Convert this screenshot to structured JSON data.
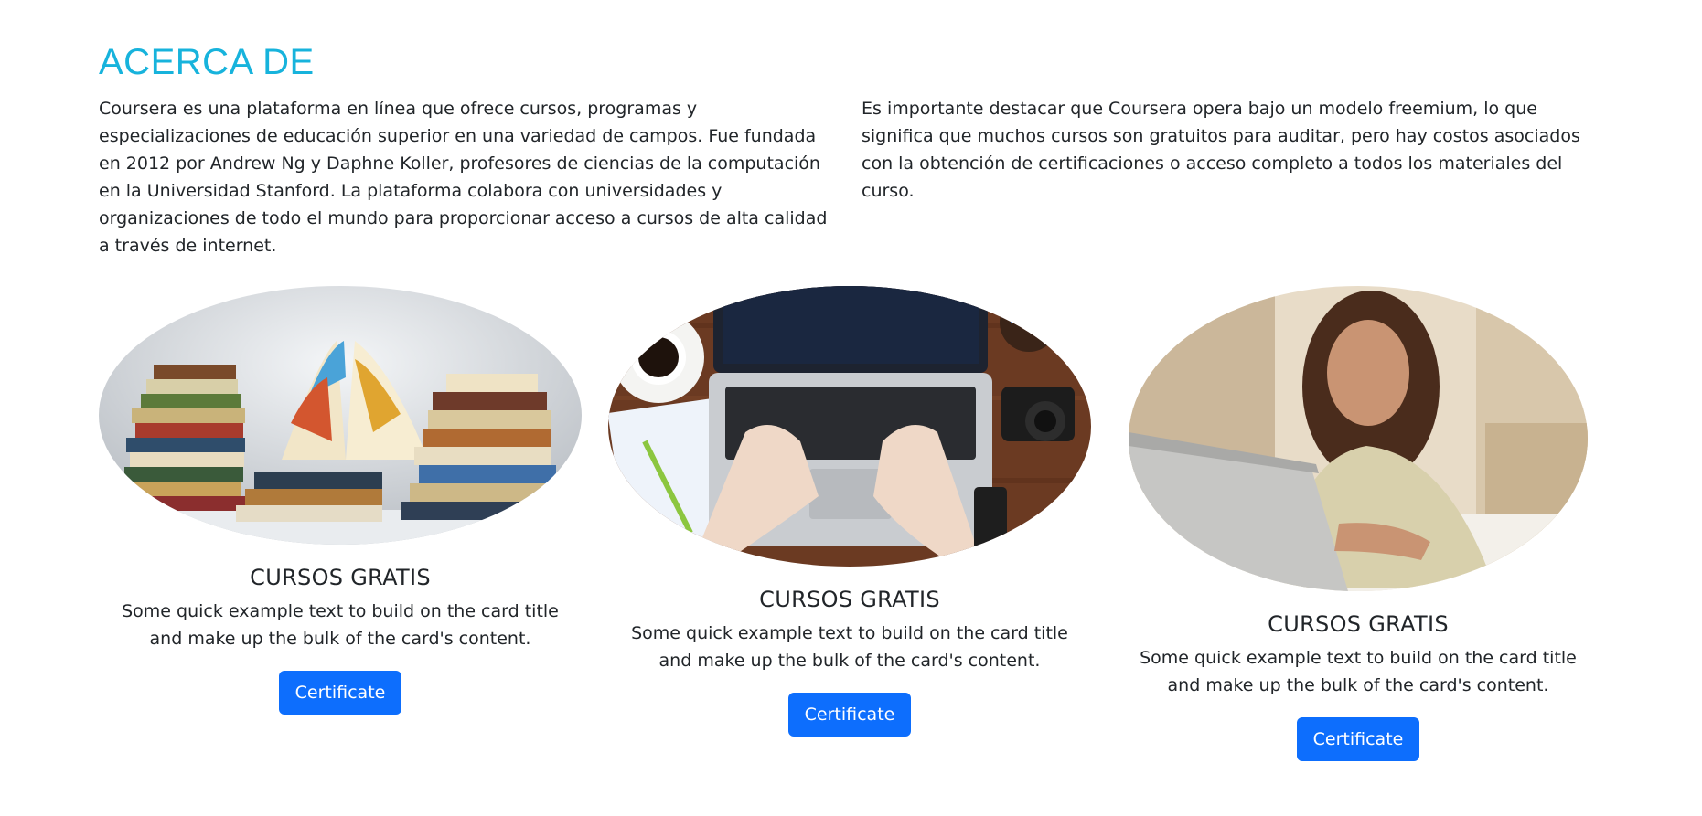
{
  "about": {
    "title": "ACERCA DE",
    "paragraph_left": "Coursera es una plataforma en línea que ofrece cursos, programas y especializaciones de educación superior en una variedad de campos. Fue fundada en 2012 por Andrew Ng y Daphne Koller, profesores de ciencias de la computación en la Universidad Stanford. La plataforma colabora con universidades y organizaciones de todo el mundo para proporcionar acceso a cursos de alta calidad a través de internet.",
    "paragraph_right": "Es importante destacar que Coursera opera bajo un modelo freemium, lo que significa que muchos cursos son gratuitos para auditar, pero hay costos asociados con la obtención de certificaciones o acceso completo a todos los materiales del curso."
  },
  "cards": [
    {
      "image": "books-stack-image",
      "title": "CURSOS GRATIS",
      "text": "Some quick example text to build on the card title and make up the bulk of the card's content.",
      "button": "Certificate"
    },
    {
      "image": "laptop-desk-image",
      "title": "CURSOS GRATIS",
      "text": "Some quick example text to build on the card title and make up the bulk of the card's content.",
      "button": "Certificate"
    },
    {
      "image": "woman-laptop-image",
      "title": "CURSOS GRATIS",
      "text": "Some quick example text to build on the card title and make up the bulk of the card's content.",
      "button": "Certificate"
    }
  ],
  "colors": {
    "title_accent": "#17b3dc",
    "button_primary": "#0d6efd",
    "text": "#212529"
  }
}
